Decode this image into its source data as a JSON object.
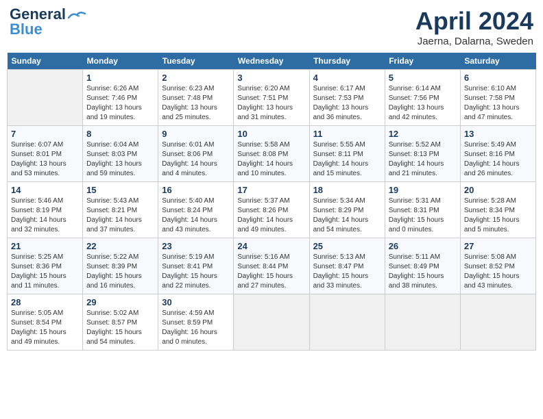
{
  "header": {
    "logo_line1": "General",
    "logo_line2": "Blue",
    "month": "April 2024",
    "location": "Jaerna, Dalarna, Sweden"
  },
  "weekdays": [
    "Sunday",
    "Monday",
    "Tuesday",
    "Wednesday",
    "Thursday",
    "Friday",
    "Saturday"
  ],
  "weeks": [
    [
      {
        "day": "",
        "info": ""
      },
      {
        "day": "1",
        "info": "Sunrise: 6:26 AM\nSunset: 7:46 PM\nDaylight: 13 hours\nand 19 minutes."
      },
      {
        "day": "2",
        "info": "Sunrise: 6:23 AM\nSunset: 7:48 PM\nDaylight: 13 hours\nand 25 minutes."
      },
      {
        "day": "3",
        "info": "Sunrise: 6:20 AM\nSunset: 7:51 PM\nDaylight: 13 hours\nand 31 minutes."
      },
      {
        "day": "4",
        "info": "Sunrise: 6:17 AM\nSunset: 7:53 PM\nDaylight: 13 hours\nand 36 minutes."
      },
      {
        "day": "5",
        "info": "Sunrise: 6:14 AM\nSunset: 7:56 PM\nDaylight: 13 hours\nand 42 minutes."
      },
      {
        "day": "6",
        "info": "Sunrise: 6:10 AM\nSunset: 7:58 PM\nDaylight: 13 hours\nand 47 minutes."
      }
    ],
    [
      {
        "day": "7",
        "info": "Sunrise: 6:07 AM\nSunset: 8:01 PM\nDaylight: 13 hours\nand 53 minutes."
      },
      {
        "day": "8",
        "info": "Sunrise: 6:04 AM\nSunset: 8:03 PM\nDaylight: 13 hours\nand 59 minutes."
      },
      {
        "day": "9",
        "info": "Sunrise: 6:01 AM\nSunset: 8:06 PM\nDaylight: 14 hours\nand 4 minutes."
      },
      {
        "day": "10",
        "info": "Sunrise: 5:58 AM\nSunset: 8:08 PM\nDaylight: 14 hours\nand 10 minutes."
      },
      {
        "day": "11",
        "info": "Sunrise: 5:55 AM\nSunset: 8:11 PM\nDaylight: 14 hours\nand 15 minutes."
      },
      {
        "day": "12",
        "info": "Sunrise: 5:52 AM\nSunset: 8:13 PM\nDaylight: 14 hours\nand 21 minutes."
      },
      {
        "day": "13",
        "info": "Sunrise: 5:49 AM\nSunset: 8:16 PM\nDaylight: 14 hours\nand 26 minutes."
      }
    ],
    [
      {
        "day": "14",
        "info": "Sunrise: 5:46 AM\nSunset: 8:19 PM\nDaylight: 14 hours\nand 32 minutes."
      },
      {
        "day": "15",
        "info": "Sunrise: 5:43 AM\nSunset: 8:21 PM\nDaylight: 14 hours\nand 37 minutes."
      },
      {
        "day": "16",
        "info": "Sunrise: 5:40 AM\nSunset: 8:24 PM\nDaylight: 14 hours\nand 43 minutes."
      },
      {
        "day": "17",
        "info": "Sunrise: 5:37 AM\nSunset: 8:26 PM\nDaylight: 14 hours\nand 49 minutes."
      },
      {
        "day": "18",
        "info": "Sunrise: 5:34 AM\nSunset: 8:29 PM\nDaylight: 14 hours\nand 54 minutes."
      },
      {
        "day": "19",
        "info": "Sunrise: 5:31 AM\nSunset: 8:31 PM\nDaylight: 15 hours\nand 0 minutes."
      },
      {
        "day": "20",
        "info": "Sunrise: 5:28 AM\nSunset: 8:34 PM\nDaylight: 15 hours\nand 5 minutes."
      }
    ],
    [
      {
        "day": "21",
        "info": "Sunrise: 5:25 AM\nSunset: 8:36 PM\nDaylight: 15 hours\nand 11 minutes."
      },
      {
        "day": "22",
        "info": "Sunrise: 5:22 AM\nSunset: 8:39 PM\nDaylight: 15 hours\nand 16 minutes."
      },
      {
        "day": "23",
        "info": "Sunrise: 5:19 AM\nSunset: 8:41 PM\nDaylight: 15 hours\nand 22 minutes."
      },
      {
        "day": "24",
        "info": "Sunrise: 5:16 AM\nSunset: 8:44 PM\nDaylight: 15 hours\nand 27 minutes."
      },
      {
        "day": "25",
        "info": "Sunrise: 5:13 AM\nSunset: 8:47 PM\nDaylight: 15 hours\nand 33 minutes."
      },
      {
        "day": "26",
        "info": "Sunrise: 5:11 AM\nSunset: 8:49 PM\nDaylight: 15 hours\nand 38 minutes."
      },
      {
        "day": "27",
        "info": "Sunrise: 5:08 AM\nSunset: 8:52 PM\nDaylight: 15 hours\nand 43 minutes."
      }
    ],
    [
      {
        "day": "28",
        "info": "Sunrise: 5:05 AM\nSunset: 8:54 PM\nDaylight: 15 hours\nand 49 minutes."
      },
      {
        "day": "29",
        "info": "Sunrise: 5:02 AM\nSunset: 8:57 PM\nDaylight: 15 hours\nand 54 minutes."
      },
      {
        "day": "30",
        "info": "Sunrise: 4:59 AM\nSunset: 8:59 PM\nDaylight: 16 hours\nand 0 minutes."
      },
      {
        "day": "",
        "info": ""
      },
      {
        "day": "",
        "info": ""
      },
      {
        "day": "",
        "info": ""
      },
      {
        "day": "",
        "info": ""
      }
    ]
  ]
}
